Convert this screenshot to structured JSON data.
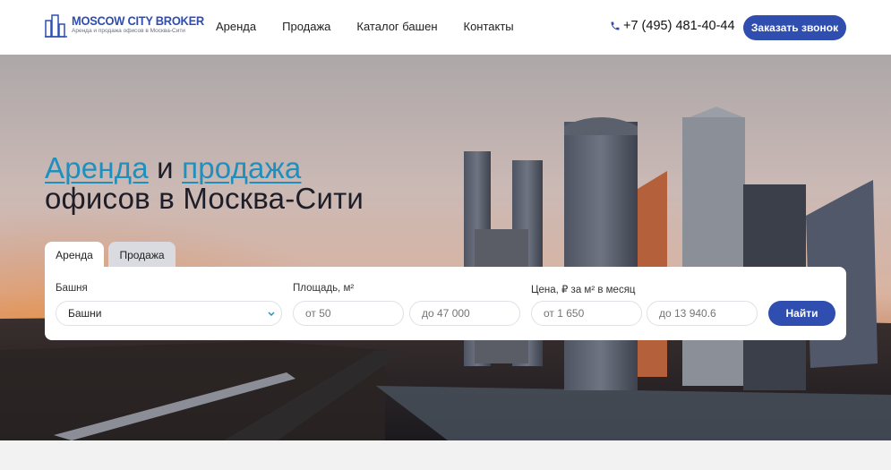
{
  "header": {
    "logo_title": "MOSCOW CITY BROKER",
    "logo_subtitle": "Аренда и продажа офисов в Москва-Сити",
    "nav": [
      "Аренда",
      "Продажа",
      "Каталог башен",
      "Контакты"
    ],
    "phone": "+7 (495) 481-40-44",
    "call_button": "Заказать звонок"
  },
  "hero": {
    "title_word1": "Аренда",
    "title_and": " и ",
    "title_word2": "продажа",
    "title_line2": "офисов в Москва-Сити"
  },
  "search": {
    "tabs": [
      "Аренда",
      "Продажа"
    ],
    "active_tab": "Аренда",
    "tower_label": "Башня",
    "tower_value": "Башни",
    "area_label": "Площадь, м²",
    "area_from_placeholder": "от 50",
    "area_to_placeholder": "до 47 000",
    "price_label": "Цена, ₽ за м² в месяц",
    "price_from_placeholder": "от 1 650",
    "price_to_placeholder": "до 13 940.6",
    "submit": "Найти"
  },
  "colors": {
    "brand_blue": "#2f4eb0",
    "accent_cyan": "#1f8fbd"
  },
  "icons": [
    "building-logo-icon",
    "phone-icon",
    "chevron-down-icon"
  ]
}
